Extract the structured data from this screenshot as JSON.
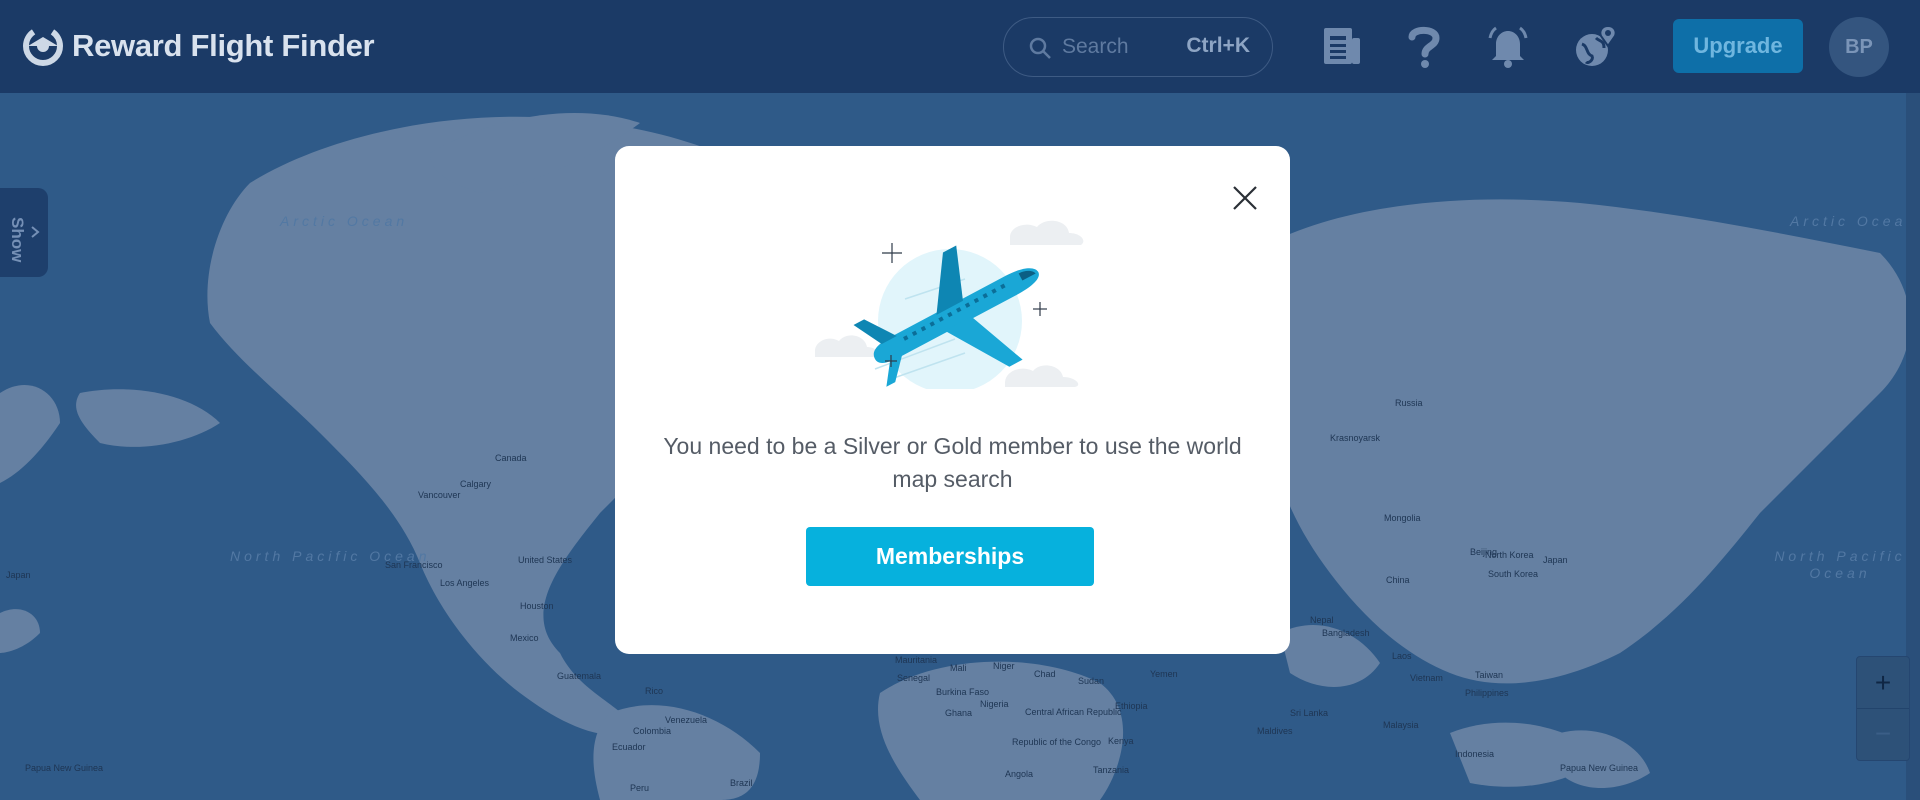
{
  "header": {
    "brand": "Reward Flight Finder",
    "search_placeholder": "Search",
    "search_shortcut": "Ctrl+K",
    "upgrade_label": "Upgrade",
    "avatar_initials": "BP",
    "icons": [
      "news-icon",
      "help-icon",
      "notifications-bell-icon",
      "world-map-pin-icon"
    ]
  },
  "sidebar": {
    "show_label": "Show"
  },
  "map": {
    "labels": {
      "canada": "Canada",
      "calgary": "Calgary",
      "vancouver": "Vancouver",
      "sanfrancisco": "San Francisco",
      "losangeles": "Los Angeles",
      "unitedstates": "United States",
      "houston": "Houston",
      "mexico": "Mexico",
      "guatemala": "Guatemala",
      "colombia": "Colombia",
      "venezuela": "Venezuela",
      "ecuador": "Ecuador",
      "peru": "Peru",
      "brazil": "Brazil",
      "mauritania": "Mauritania",
      "mali": "Mali",
      "niger": "Niger",
      "chad": "Chad",
      "sudan": "Sudan",
      "senegal": "Senegal",
      "burkinafaso": "Burkina Faso",
      "ghana": "Ghana",
      "nigeria": "Nigeria",
      "car": "Central African Republic",
      "ethiopia": "Ethiopia",
      "congo": "Republic of the Congo",
      "kenya": "Kenya",
      "tanzania": "Tanzania",
      "angola": "Angola",
      "yemen": "Yemen",
      "russia": "Russia",
      "krasnoyarsk": "Krasnoyarsk",
      "mongolia": "Mongolia",
      "china": "China",
      "beijing": "Beijing",
      "northkorea": "North Korea",
      "southkorea": "South Korea",
      "japan": "Japan",
      "nepal": "Nepal",
      "bangladesh": "Bangladesh",
      "laos": "Laos",
      "vietnam": "Vietnam",
      "philippines": "Philippines",
      "taiwan": "Taiwan",
      "srilanka": "Sri Lanka",
      "maldives": "Maldives",
      "malaysia": "Malaysia",
      "indonesia": "Indonesia",
      "papuanewguinea": "Papua New Guinea",
      "japan_left": "Japan",
      "papuanewguinea_left": "Papua New Guinea",
      "rico": "Rico"
    },
    "oceans": {
      "north_pacific_left": "North Pacific Ocean",
      "north_pacific_right": "North Pacific Ocean",
      "arctic_ocean_left": "Arctic Ocean",
      "arctic_ocean_right": "Arctic Ocean"
    }
  },
  "modal": {
    "message": "You need to be a Silver or Gold member to use the world map search",
    "button_label": "Memberships"
  },
  "zoom": {
    "in": "+",
    "out": "−"
  },
  "colors": {
    "header_bg": "#1b3a66",
    "map_water": "#2f5a88",
    "map_land": "#6f87a7",
    "accent": "#06b1dd",
    "upgrade_bg": "#0e6fa8"
  }
}
